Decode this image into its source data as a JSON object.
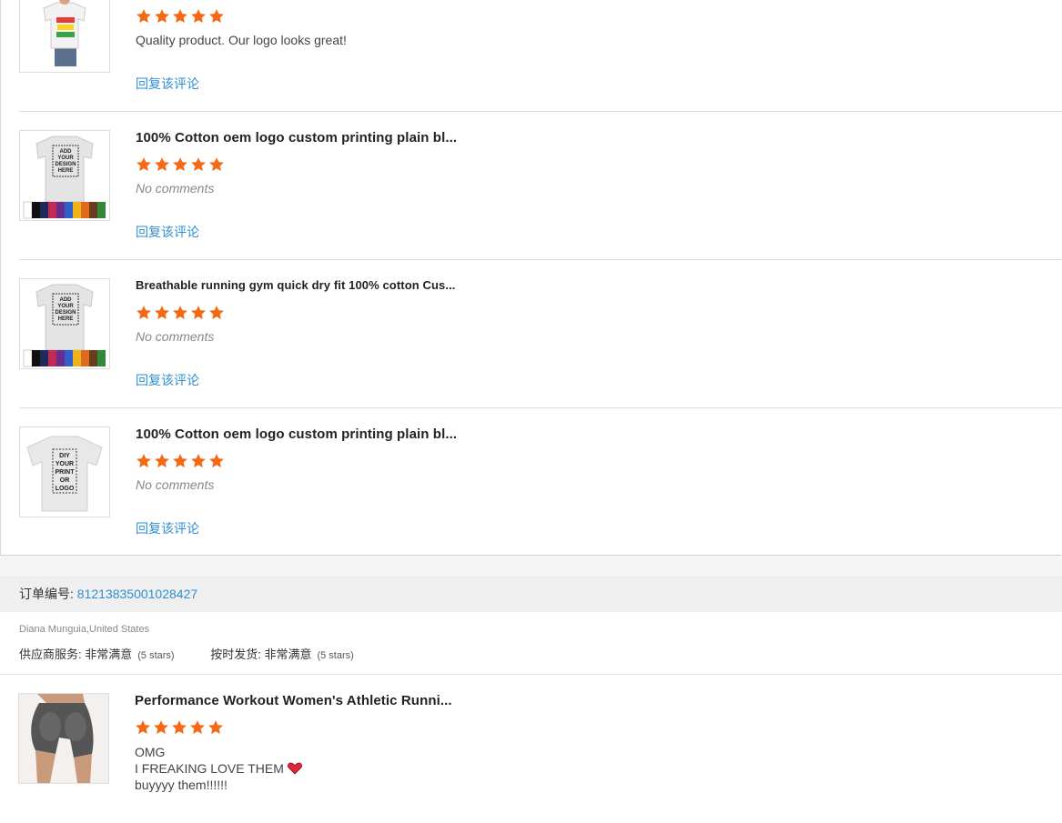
{
  "reviews": [
    {
      "title": "",
      "rating": 5,
      "comment": "Quality product. Our logo looks great!",
      "reply_label": "回复该评论",
      "thumb": "kid-tshirt-image"
    },
    {
      "title": "100% Cotton oem logo custom printing plain bl...",
      "rating": 5,
      "comment": "No comments",
      "reply_label": "回复该评论",
      "thumb": "tshirt-colors-image",
      "thumb_text": [
        "ADD",
        "YOUR",
        "DESIGN",
        "HERE"
      ]
    },
    {
      "title": "Breathable running gym quick dry fit 100% cotton Cus...",
      "rating": 5,
      "comment": "No comments",
      "reply_label": "回复该评论",
      "thumb": "tshirt-colors-image",
      "thumb_text": [
        "ADD",
        "YOUR",
        "DESIGN",
        "HERE"
      ]
    },
    {
      "title": "100% Cotton oem logo custom printing plain bl...",
      "rating": 5,
      "comment": "No comments",
      "reply_label": "回复该评论",
      "thumb": "tshirt-diy-image",
      "thumb_text": [
        "DIY",
        "YOUR",
        "PRINT",
        "OR",
        "LOGO"
      ]
    }
  ],
  "order": {
    "label": "订单编号: ",
    "number": "81213835001028427",
    "buyer": "Diana Munguia,United States",
    "supplier_service_label": "供应商服务: ",
    "supplier_service_value": "非常满意",
    "supplier_service_stars": "(5 stars)",
    "ontime_label": "按时发货: ",
    "ontime_value": "非常满意",
    "ontime_stars": "(5 stars)"
  },
  "last_review": {
    "title": "Performance Workout Women's Athletic Runni...",
    "rating": 5,
    "comment_lines": [
      "OMG",
      "I FREAKING LOVE THEM",
      "buyyyy them!!!!!!"
    ],
    "thumb": "leggings-shorts-image"
  },
  "colors": {
    "star": "#f46a14",
    "link": "#2f8fd0"
  }
}
